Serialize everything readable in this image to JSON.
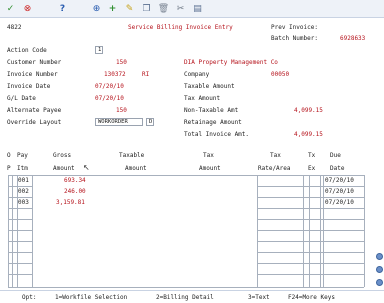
{
  "toolbar": {
    "icons": [
      "check-icon",
      "cancel-icon",
      "help-icon",
      "binoculars-icon",
      "add-icon",
      "edit-icon",
      "copy-icon",
      "trash-icon",
      "cut-icon",
      "paste-icon"
    ]
  },
  "header": {
    "screen_number": "4822",
    "title": "Service Billing Invoice Entry",
    "prev_invoice_label": "Prev Invoice:",
    "batch_number_label": "Batch Number:",
    "batch_number": "6928633"
  },
  "form": {
    "action_code_label": "Action Code",
    "action_code": "1",
    "customer_number_label": "Customer Number",
    "customer_number": "150",
    "customer_name": "DIA Property Management Co",
    "invoice_number_label": "Invoice Number",
    "invoice_number": "130372",
    "invoice_type": "RI",
    "company_label": "Company",
    "company": "00050",
    "invoice_date_label": "Invoice Date",
    "invoice_date": "07/20/10",
    "taxable_amount_label": "Taxable Amount",
    "gl_date_label": "G/L Date",
    "gl_date": "07/20/10",
    "tax_amount_label": "Tax Amount",
    "alternate_payee_label": "Alternate Payee",
    "alternate_payee": "150",
    "non_taxable_label": "Non-Taxable Amt",
    "non_taxable_amount": "4,099.15",
    "override_layout_label": "Override Layout",
    "override_layout": "WORKORDER",
    "override_layout_flag": "D",
    "retainage_label": "Retainage Amount",
    "total_invoice_label": "Total Invoice Amt.",
    "total_invoice_amount": "4,099.15"
  },
  "grid": {
    "header_row1": [
      "O",
      "Pay",
      "Gross",
      "Taxable",
      "Tax",
      "Tax",
      "Tx",
      "Due"
    ],
    "header_row2": [
      "P",
      "Itm",
      "Amount",
      "Amount",
      "Amount",
      "Rate/Area",
      "Ex",
      "Date"
    ],
    "rows": [
      {
        "item": "001",
        "gross": "693.34",
        "due_date": "07/20/10"
      },
      {
        "item": "002",
        "gross": "246.00",
        "due_date": "07/20/10"
      },
      {
        "item": "003",
        "gross": "3,159.81",
        "due_date": "07/20/10"
      }
    ]
  },
  "footer": {
    "opt_label": "Opt:",
    "options": [
      "1=Workfile Selection",
      "2=Billing Detail",
      "3=Text",
      "F24=More Keys"
    ]
  }
}
